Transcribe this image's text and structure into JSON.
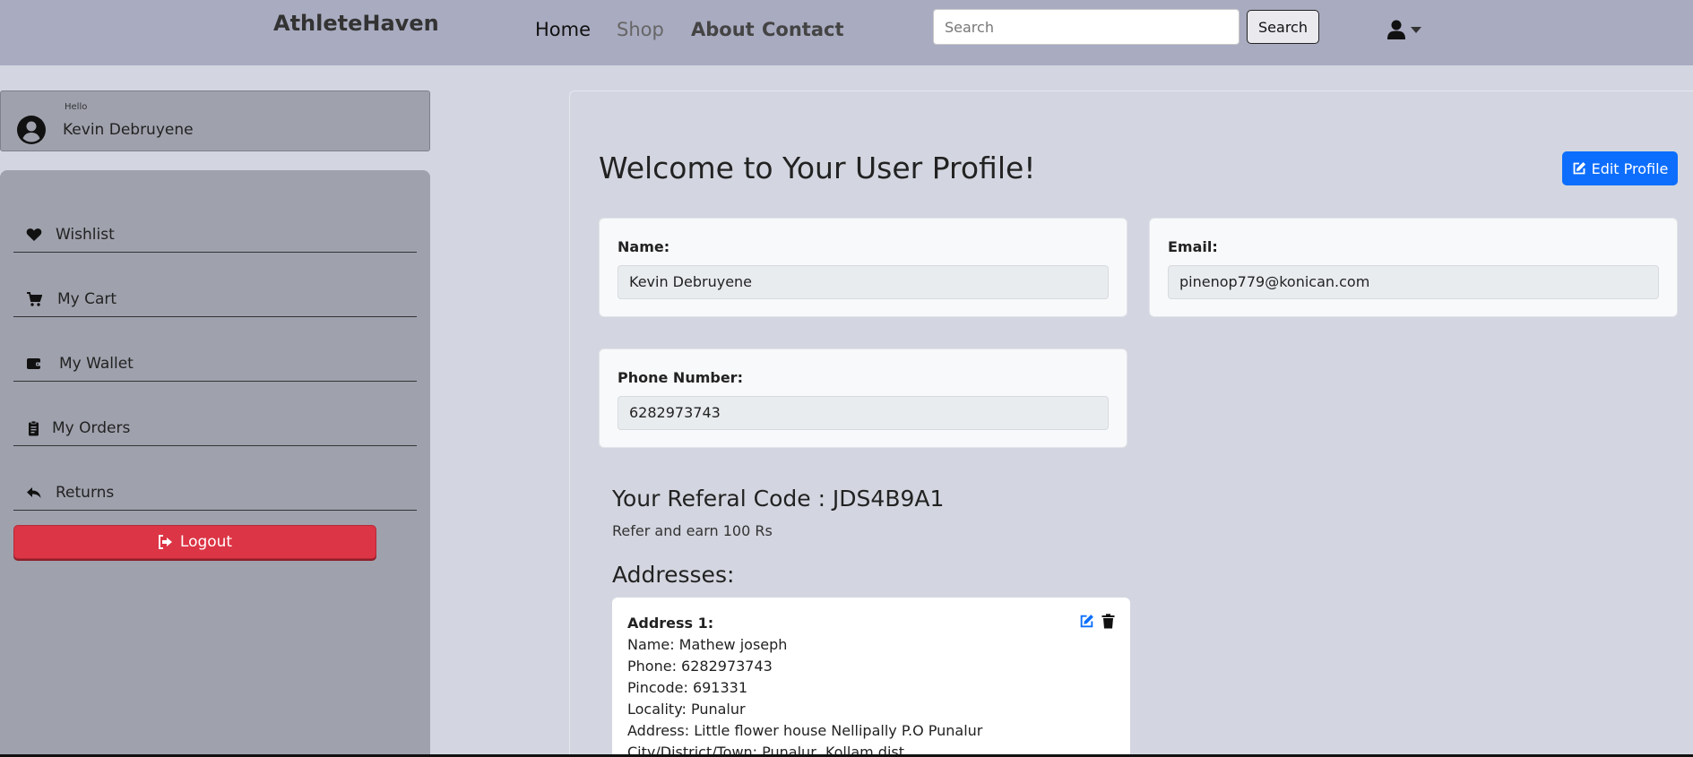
{
  "header": {
    "brand": "AthleteHaven",
    "nav": [
      "Home",
      "Shop",
      "About",
      "Contact"
    ],
    "search_placeholder": "Search",
    "search_button": "Search",
    "user_icon": "user-icon",
    "dropdown_icon": "caret-down-icon"
  },
  "greeting": {
    "hello": "Hello",
    "name": "Kevin Debruyene",
    "icon": "user-circle-icon"
  },
  "sidebar": {
    "items": [
      {
        "label": "Wishlist",
        "icon": "heart-icon"
      },
      {
        "label": "My Cart",
        "icon": "cart-icon"
      },
      {
        "label": "My Wallet",
        "icon": "wallet-icon"
      },
      {
        "label": "My Orders",
        "icon": "clipboard-icon"
      },
      {
        "label": "Returns",
        "icon": "reply-icon"
      }
    ],
    "logout": "Logout"
  },
  "profile": {
    "title": "Welcome to Your User Profile!",
    "edit_button": "Edit Profile",
    "name_label": "Name:",
    "name_value": "Kevin Debruyene",
    "email_label": "Email:",
    "email_value": "pinenop779@konican.com",
    "phone_label": "Phone Number:",
    "phone_value": "6282973743",
    "referral_title": "Your Referal Code : JDS4B9A1",
    "referral_sub": "Refer and earn 100 Rs",
    "addresses_heading": "Addresses:"
  },
  "addresses": [
    {
      "title": "Address 1:",
      "name": "Name: Mathew joseph",
      "phone": "Phone: 6282973743",
      "pincode": "Pincode: 691331",
      "locality": "Locality: Punalur",
      "address": "Address: Little flower house Nellipally P.O Punalur",
      "city": "City/District/Town: Punalur, Kollam dist"
    }
  ],
  "colors": {
    "header_bg": "#a9abc0",
    "sidebar_bg": "#9fa2ad",
    "page_bg": "#d3d6e0",
    "primary": "#0d6efd",
    "danger": "#dc3545"
  }
}
